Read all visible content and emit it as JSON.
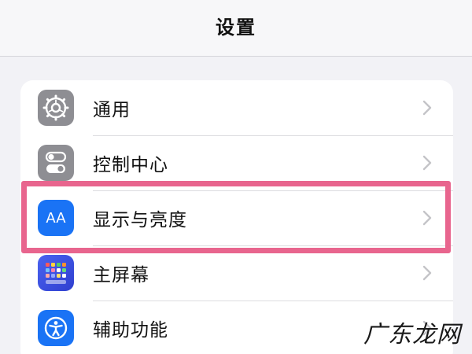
{
  "header": {
    "title": "设置"
  },
  "rows": [
    {
      "label": "通用",
      "icon": "gear-icon",
      "icon_color": "#8e8e93"
    },
    {
      "label": "控制中心",
      "icon": "toggles-icon",
      "icon_color": "#8e8e93"
    },
    {
      "label": "显示与亮度",
      "icon": "text-size-icon",
      "icon_color": "#1a73f5",
      "icon_text": "AA"
    },
    {
      "label": "主屏幕",
      "icon": "home-screen-grid-icon",
      "icon_color": "#3a4ee0"
    },
    {
      "label": "辅助功能",
      "icon": "accessibility-icon",
      "icon_color": "#1a73f5"
    }
  ],
  "watermark": "广东龙网",
  "highlight_color": "#e8658e"
}
